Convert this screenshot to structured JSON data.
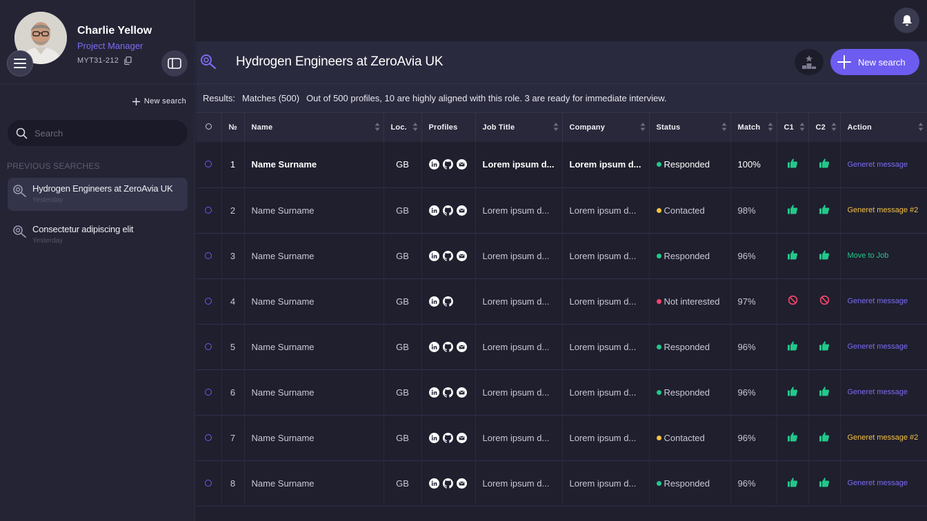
{
  "user": {
    "name": "Charlie Yellow",
    "role": "Project Manager",
    "id": "MYT31-212"
  },
  "sidebar": {
    "new_search_label": "New search",
    "search_placeholder": "Search",
    "previous_title": "PREVIOUS SEARCHES",
    "previous": [
      {
        "label": "Hydrogen Engineers at ZeroAvia UK",
        "time": "Yesterday"
      },
      {
        "label": "Consectetur adipiscing elit",
        "time": "Yesterday"
      }
    ]
  },
  "header": {
    "title": "Hydrogen Engineers at ZeroAvia UK",
    "new_search_label": "New search"
  },
  "results": {
    "label": "Results:",
    "matches": "Matches (500)",
    "summary": "Out of 500 profiles, 10 are highly aligned with this role. 3 are ready for immediate interview."
  },
  "table": {
    "columns": [
      "№",
      "Name",
      "Loc.",
      "Profiles",
      "Job Title",
      "Company",
      "Status",
      "Match",
      "C1",
      "C2",
      "Action"
    ],
    "rows": [
      {
        "n": "1",
        "name": "Name Surname",
        "loc": "GB",
        "profiles": [
          "linkedin",
          "github",
          "email"
        ],
        "job": "Lorem ipsum d...",
        "company": "Lorem ipsum d...",
        "status": "Responded",
        "status_color": "#22c88a",
        "match": "100%",
        "c1": "up",
        "c2": "up",
        "action": "Generet message",
        "action_color": "#7c6cf2"
      },
      {
        "n": "2",
        "name": "Name Surname",
        "loc": "GB",
        "profiles": [
          "linkedin",
          "github",
          "email"
        ],
        "job": "Lorem ipsum d...",
        "company": "Lorem ipsum d...",
        "status": "Contacted",
        "status_color": "#f5c242",
        "match": "98%",
        "c1": "up",
        "c2": "up",
        "action": "Generet message #2",
        "action_color": "#f5c242"
      },
      {
        "n": "3",
        "name": "Name Surname",
        "loc": "GB",
        "profiles": [
          "linkedin",
          "github",
          "email"
        ],
        "job": "Lorem ipsum d...",
        "company": "Lorem ipsum d...",
        "status": "Responded",
        "status_color": "#22c88a",
        "match": "96%",
        "c1": "up",
        "c2": "up",
        "action": "Move to Job",
        "action_color": "#22c88a"
      },
      {
        "n": "4",
        "name": "Name Surname",
        "loc": "GB",
        "profiles": [
          "linkedin",
          "github"
        ],
        "job": "Lorem ipsum d...",
        "company": "Lorem ipsum d...",
        "status": "Not interested",
        "status_color": "#f0456a",
        "match": "97%",
        "c1": "ban",
        "c2": "ban",
        "action": "Generet message",
        "action_color": "#7c6cf2"
      },
      {
        "n": "5",
        "name": "Name Surname",
        "loc": "GB",
        "profiles": [
          "linkedin",
          "github",
          "email"
        ],
        "job": "Lorem ipsum d...",
        "company": "Lorem ipsum d...",
        "status": "Responded",
        "status_color": "#22c88a",
        "match": "96%",
        "c1": "up",
        "c2": "up",
        "action": "Generet message",
        "action_color": "#7c6cf2"
      },
      {
        "n": "6",
        "name": "Name Surname",
        "loc": "GB",
        "profiles": [
          "linkedin",
          "github",
          "email"
        ],
        "job": "Lorem ipsum d...",
        "company": "Lorem ipsum d...",
        "status": "Responded",
        "status_color": "#22c88a",
        "match": "96%",
        "c1": "up",
        "c2": "up",
        "action": "Generet message",
        "action_color": "#7c6cf2"
      },
      {
        "n": "7",
        "name": "Name Surname",
        "loc": "GB",
        "profiles": [
          "linkedin",
          "github",
          "email"
        ],
        "job": "Lorem ipsum d...",
        "company": "Lorem ipsum d...",
        "status": "Contacted",
        "status_color": "#f5c242",
        "match": "96%",
        "c1": "up",
        "c2": "up",
        "action": "Generet message #2",
        "action_color": "#f5c242"
      },
      {
        "n": "8",
        "name": "Name Surname",
        "loc": "GB",
        "profiles": [
          "linkedin",
          "github",
          "email"
        ],
        "job": "Lorem ipsum d...",
        "company": "Lorem ipsum d...",
        "status": "Responded",
        "status_color": "#22c88a",
        "match": "96%",
        "c1": "up",
        "c2": "up",
        "action": "Generet message",
        "action_color": "#7c6cf2"
      }
    ]
  },
  "colors": {
    "accent": "#6d5cf0",
    "green": "#22c88a",
    "yellow": "#f5c242",
    "red": "#f0456a"
  }
}
